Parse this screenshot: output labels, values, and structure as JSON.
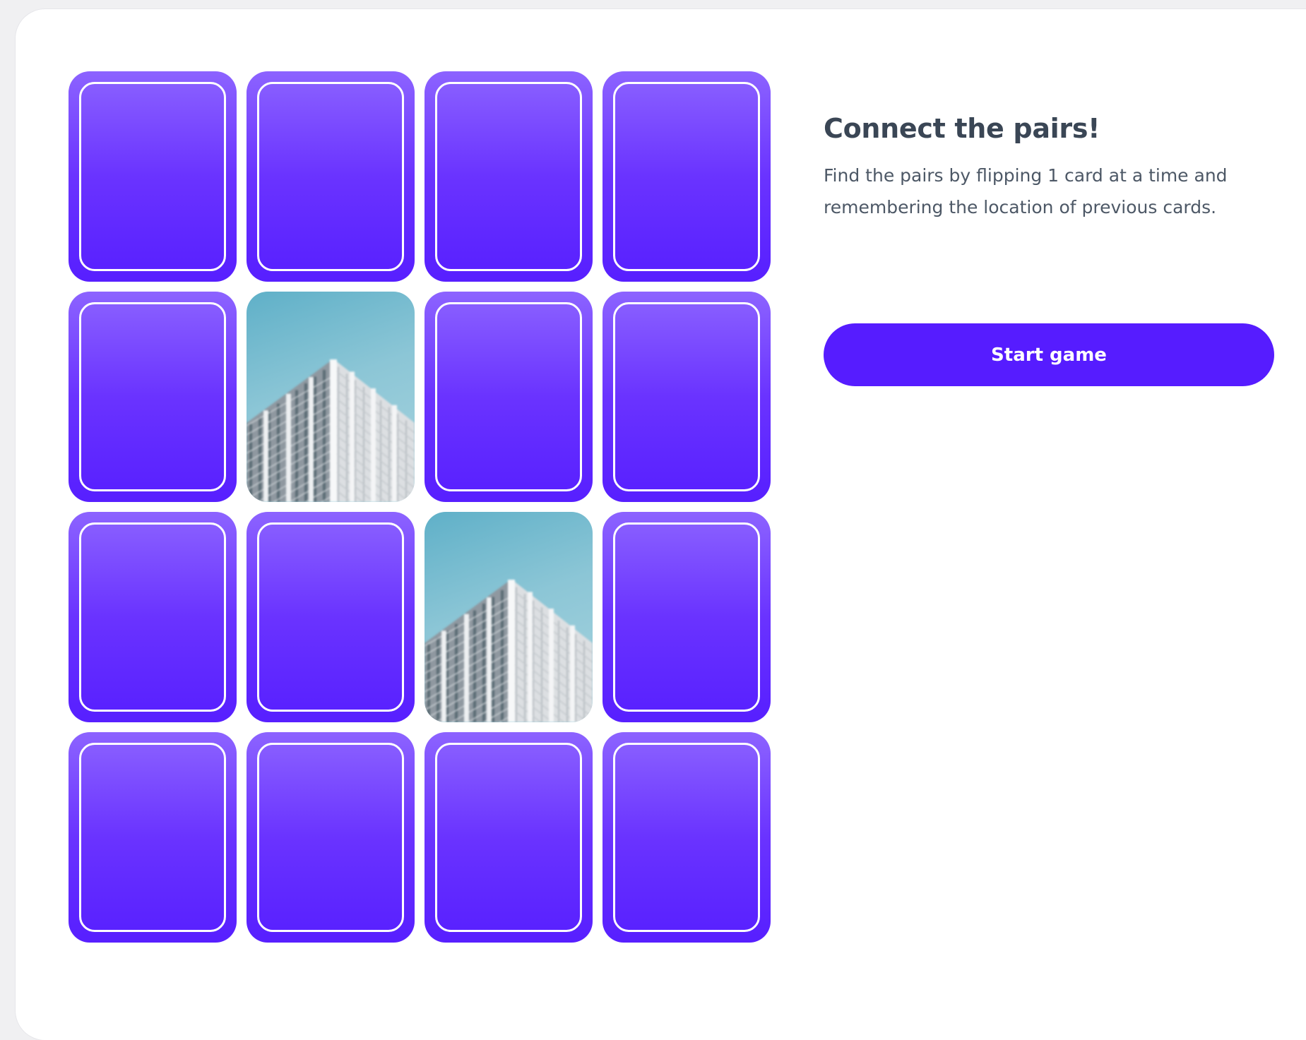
{
  "game": {
    "title": "Connect the pairs!",
    "description": "Find the pairs by flipping 1 card at a time and remembering the location of previous cards.",
    "start_label": "Start game",
    "accent_color": "#561cff",
    "grid": {
      "rows": 4,
      "cols": 4
    },
    "cards": [
      {
        "state": "face-down"
      },
      {
        "state": "face-down"
      },
      {
        "state": "face-down"
      },
      {
        "state": "face-down"
      },
      {
        "state": "face-down"
      },
      {
        "state": "face-up",
        "image": "skyscraper-image"
      },
      {
        "state": "face-down"
      },
      {
        "state": "face-down"
      },
      {
        "state": "face-down"
      },
      {
        "state": "face-down"
      },
      {
        "state": "face-up",
        "image": "skyscraper-image"
      },
      {
        "state": "face-down"
      },
      {
        "state": "face-down"
      },
      {
        "state": "face-down"
      },
      {
        "state": "face-down"
      },
      {
        "state": "face-down"
      }
    ]
  }
}
